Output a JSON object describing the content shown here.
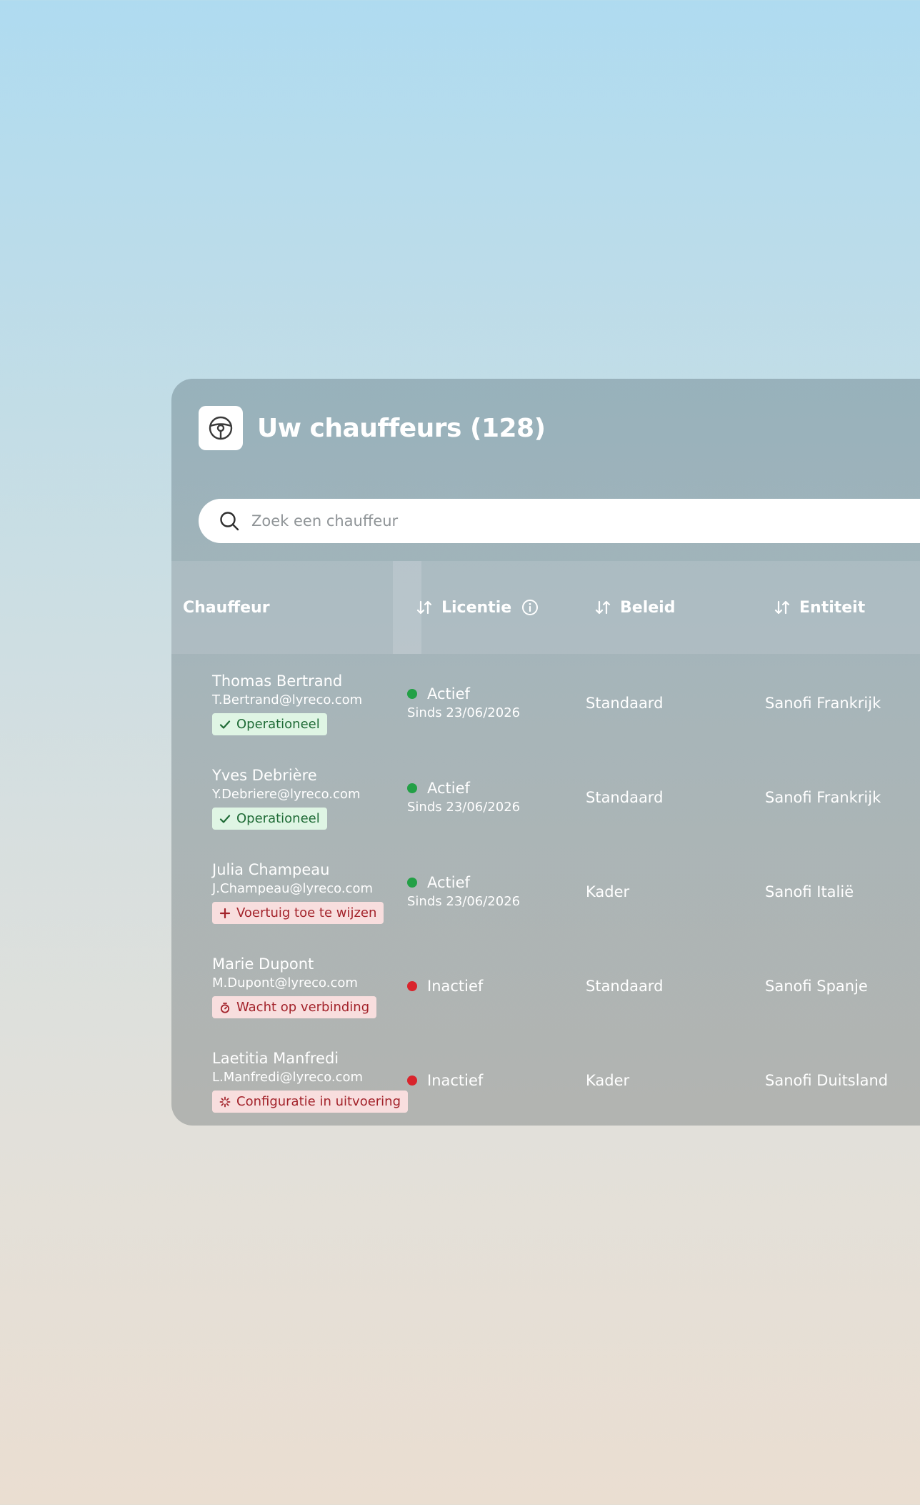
{
  "header": {
    "title": "Uw chauffeurs (128)",
    "icon": "steering-wheel-icon"
  },
  "search": {
    "placeholder": "Zoek een chauffeur",
    "value": "",
    "icon": "search-icon"
  },
  "table": {
    "columns": [
      {
        "key": "driver",
        "label": "Chauffeur",
        "sortable": false,
        "info": false
      },
      {
        "key": "licence",
        "label": "Licentie",
        "sortable": true,
        "info": true
      },
      {
        "key": "policy",
        "label": "Beleid",
        "sortable": true,
        "info": false
      },
      {
        "key": "entity",
        "label": "Entiteit",
        "sortable": true,
        "info": false
      }
    ],
    "rows": [
      {
        "name": "Thomas Bertrand",
        "email": "T.Bertrand@lyreco.com",
        "badge": {
          "label": "Operationeel",
          "type": "ok",
          "icon": "check-icon"
        },
        "licence_status": "Actief",
        "licence_color": "#23a046",
        "licence_since": "Sinds 23/06/2026",
        "policy": "Standaard",
        "entity": "Sanofi Frankrijk"
      },
      {
        "name": "Yves Debrière",
        "email": "Y.Debriere@lyreco.com",
        "badge": {
          "label": "Operationeel",
          "type": "ok",
          "icon": "check-icon"
        },
        "licence_status": "Actief",
        "licence_color": "#23a046",
        "licence_since": "Sinds 23/06/2026",
        "policy": "Standaard",
        "entity": "Sanofi Frankrijk"
      },
      {
        "name": "Julia Champeau",
        "email": "J.Champeau@lyreco.com",
        "badge": {
          "label": "Voertuig toe te wijzen",
          "type": "warn",
          "icon": "plus-icon"
        },
        "licence_status": "Actief",
        "licence_color": "#23a046",
        "licence_since": "Sinds 23/06/2026",
        "policy": "Kader",
        "entity": "Sanofi Italië"
      },
      {
        "name": "Marie Dupont",
        "email": "M.Dupont@lyreco.com",
        "badge": {
          "label": "Wacht op verbinding",
          "type": "warn",
          "icon": "stopwatch-icon"
        },
        "licence_status": "Inactief",
        "licence_color": "#d9242c",
        "licence_since": "",
        "policy": "Standaard",
        "entity": "Sanofi Spanje"
      },
      {
        "name": "Laetitia Manfredi",
        "email": "L.Manfredi@lyreco.com",
        "badge": {
          "label": "Configuratie in uitvoering",
          "type": "warn",
          "icon": "spinner-icon"
        },
        "licence_status": "Inactief",
        "licence_color": "#d9242c",
        "licence_since": "",
        "policy": "Kader",
        "entity": "Sanofi Duitsland"
      }
    ]
  }
}
